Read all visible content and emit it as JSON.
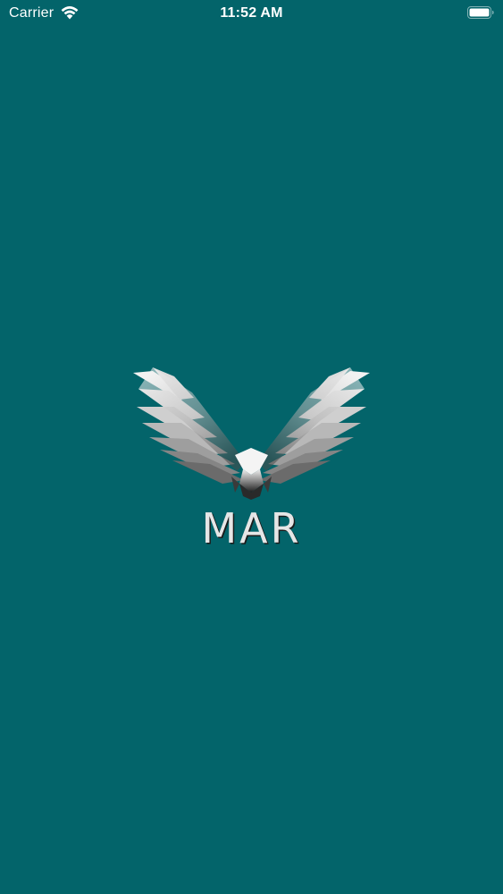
{
  "status_bar": {
    "carrier": "Carrier",
    "time": "11:52 AM",
    "wifi_icon": "wifi-icon",
    "battery_icon": "battery-icon"
  },
  "splash": {
    "brand_name": "MAR",
    "logo_icon": "eagle-logo-icon",
    "background_color": "#03646a",
    "text_color": "#e6e6e6"
  }
}
